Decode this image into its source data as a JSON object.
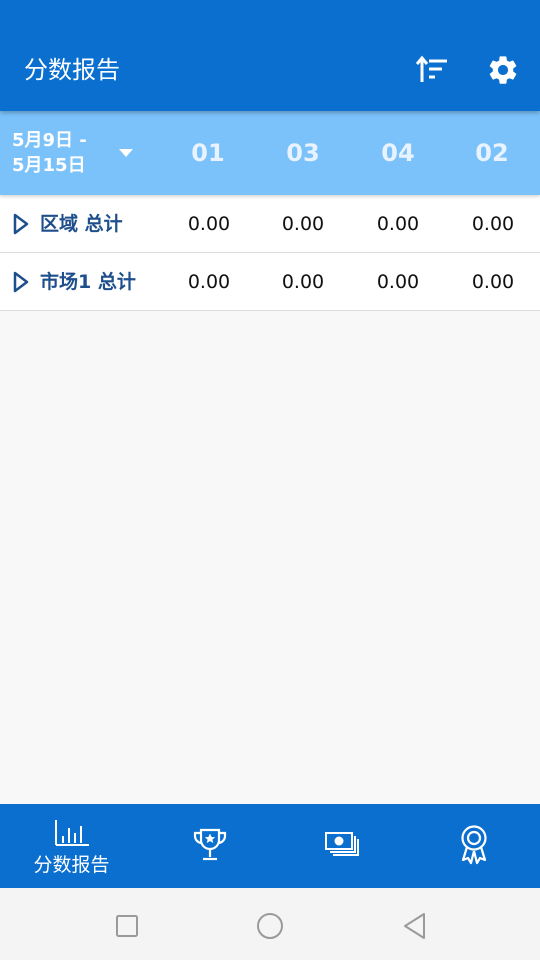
{
  "appbar": {
    "title": "分数报告",
    "sort_icon": "sort-icon",
    "settings_icon": "gear-icon"
  },
  "header": {
    "date_line1": "5月9日 -",
    "date_line2": "5月15日",
    "columns": [
      "01",
      "03",
      "04",
      "02"
    ]
  },
  "rows": [
    {
      "label": "区域 总计",
      "values": [
        "0.00",
        "0.00",
        "0.00",
        "0.00"
      ]
    },
    {
      "label": "市场1 总计",
      "values": [
        "0.00",
        "0.00",
        "0.00",
        "0.00"
      ]
    }
  ],
  "bottom_nav": {
    "items": [
      {
        "label": "分数报告",
        "icon": "bar-chart-icon",
        "active": true
      },
      {
        "label": "",
        "icon": "trophy-icon"
      },
      {
        "label": "",
        "icon": "money-icon"
      },
      {
        "label": "",
        "icon": "award-ribbon-icon"
      }
    ]
  },
  "system_nav": {
    "icons": [
      "square-icon",
      "circle-icon",
      "back-triangle-icon"
    ]
  },
  "colors": {
    "primary": "#0a6fce",
    "header_light": "#7cc2fa",
    "row_label": "#1e4f8c"
  }
}
